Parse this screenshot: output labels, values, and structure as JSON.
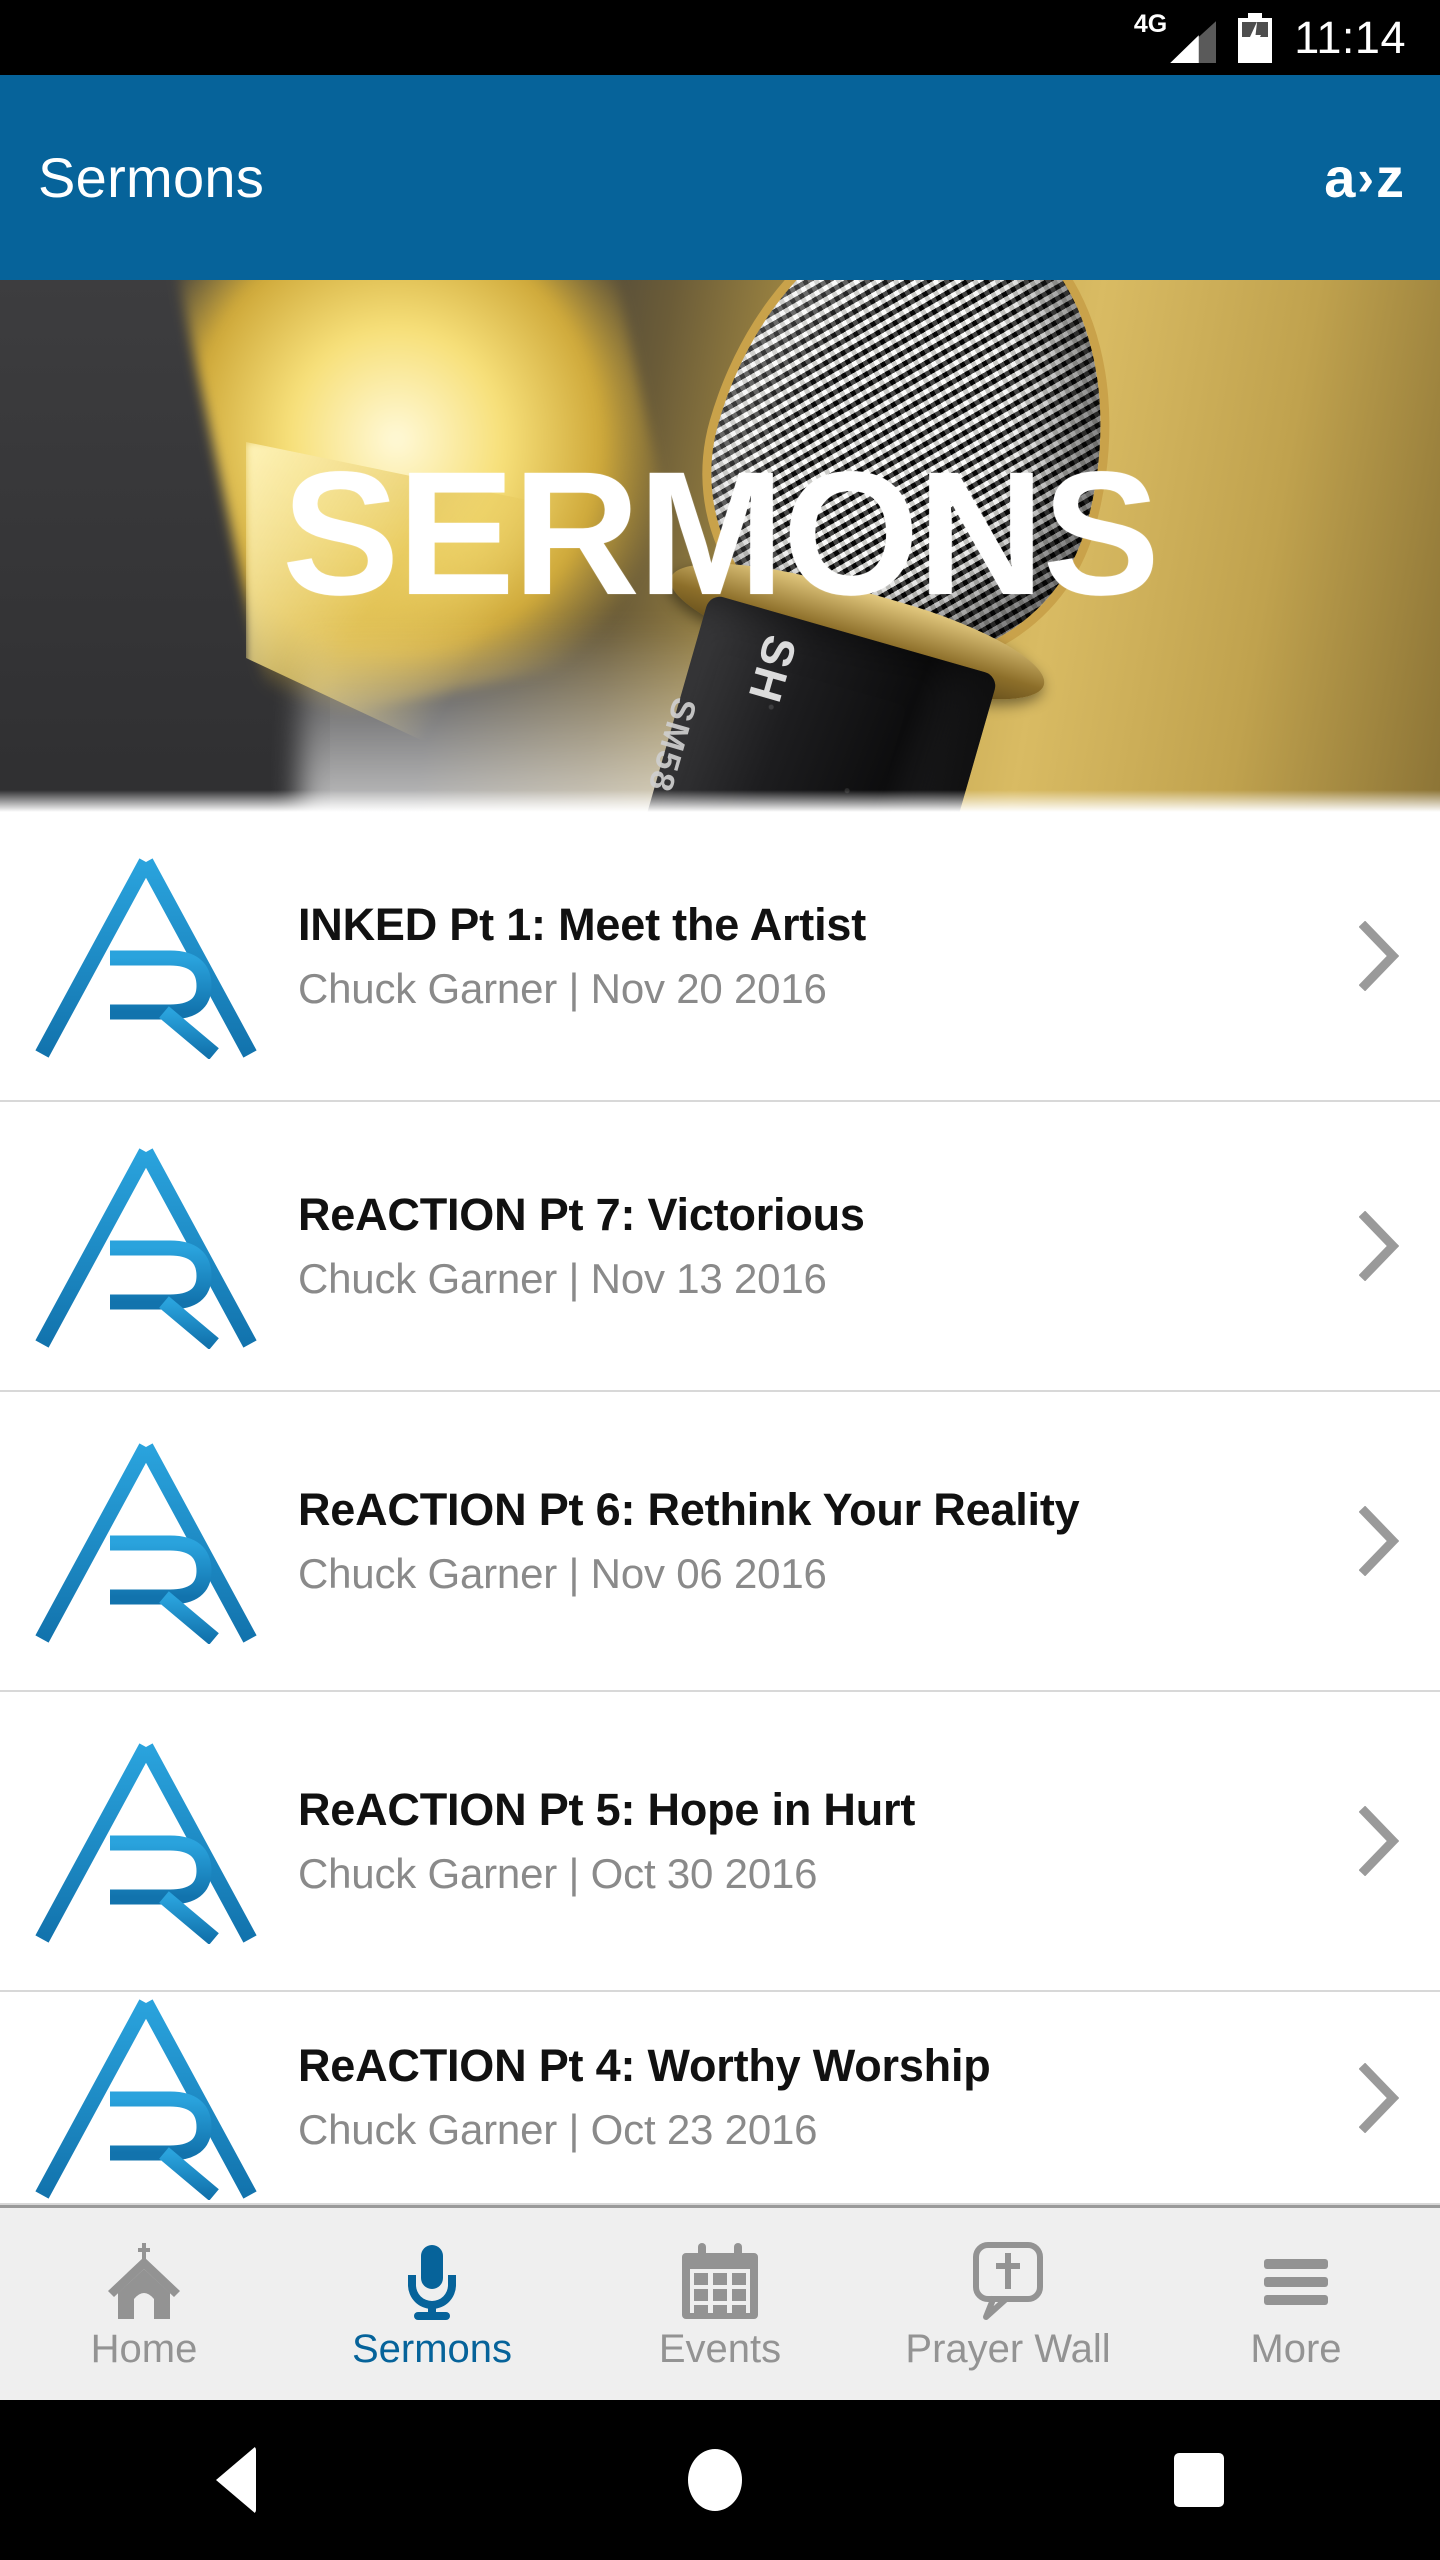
{
  "status_bar": {
    "network_label": "4G",
    "time": "11:14",
    "icons": [
      "signal-bars-icon",
      "battery-charging-icon"
    ]
  },
  "app_bar": {
    "title": "Sermons",
    "sort_button": {
      "name": "alphabetical-sort-button",
      "a": "a",
      "gt": "›",
      "z": "z"
    },
    "background_color": "#06639a"
  },
  "hero": {
    "title": "SERMONS",
    "image_description": "microphone-banner",
    "mic_label_model": "SM58",
    "mic_label_brand": "SH"
  },
  "list": {
    "items": [
      {
        "title": "INKED Pt 1: Meet the Artist",
        "meta": "Chuck Garner | Nov 20 2016",
        "thumbnail": "ar-monogram-logo",
        "chevron": "chevron-right-icon"
      },
      {
        "title": "ReACTION Pt 7: Victorious",
        "meta": "Chuck Garner | Nov 13 2016",
        "thumbnail": "ar-monogram-logo",
        "chevron": "chevron-right-icon"
      },
      {
        "title": "ReACTION Pt 6: Rethink Your Reality",
        "meta": "Chuck Garner | Nov 06 2016",
        "thumbnail": "ar-monogram-logo",
        "chevron": "chevron-right-icon"
      },
      {
        "title": "ReACTION Pt 5: Hope in Hurt",
        "meta": "Chuck Garner | Oct 30 2016",
        "thumbnail": "ar-monogram-logo",
        "chevron": "chevron-right-icon"
      },
      {
        "title": "ReACTION Pt 4: Worthy Worship",
        "meta": "Chuck Garner | Oct 23 2016",
        "thumbnail": "ar-monogram-logo",
        "chevron": "chevron-right-icon"
      }
    ]
  },
  "tab_bar": {
    "active_color": "#06639a",
    "inactive_color": "#939393",
    "tabs": [
      {
        "label": "Home",
        "icon": "church-icon",
        "active": false
      },
      {
        "label": "Sermons",
        "icon": "microphone-icon",
        "active": true
      },
      {
        "label": "Events",
        "icon": "calendar-icon",
        "active": false
      },
      {
        "label": "Prayer Wall",
        "icon": "speech-cross-icon",
        "active": false
      },
      {
        "label": "More",
        "icon": "hamburger-menu-icon",
        "active": false
      }
    ]
  },
  "nav_bar": {
    "buttons": [
      {
        "name": "back-button",
        "icon": "triangle-back-icon"
      },
      {
        "name": "home-button",
        "icon": "circle-home-icon"
      },
      {
        "name": "recents-button",
        "icon": "square-recents-icon"
      }
    ]
  }
}
